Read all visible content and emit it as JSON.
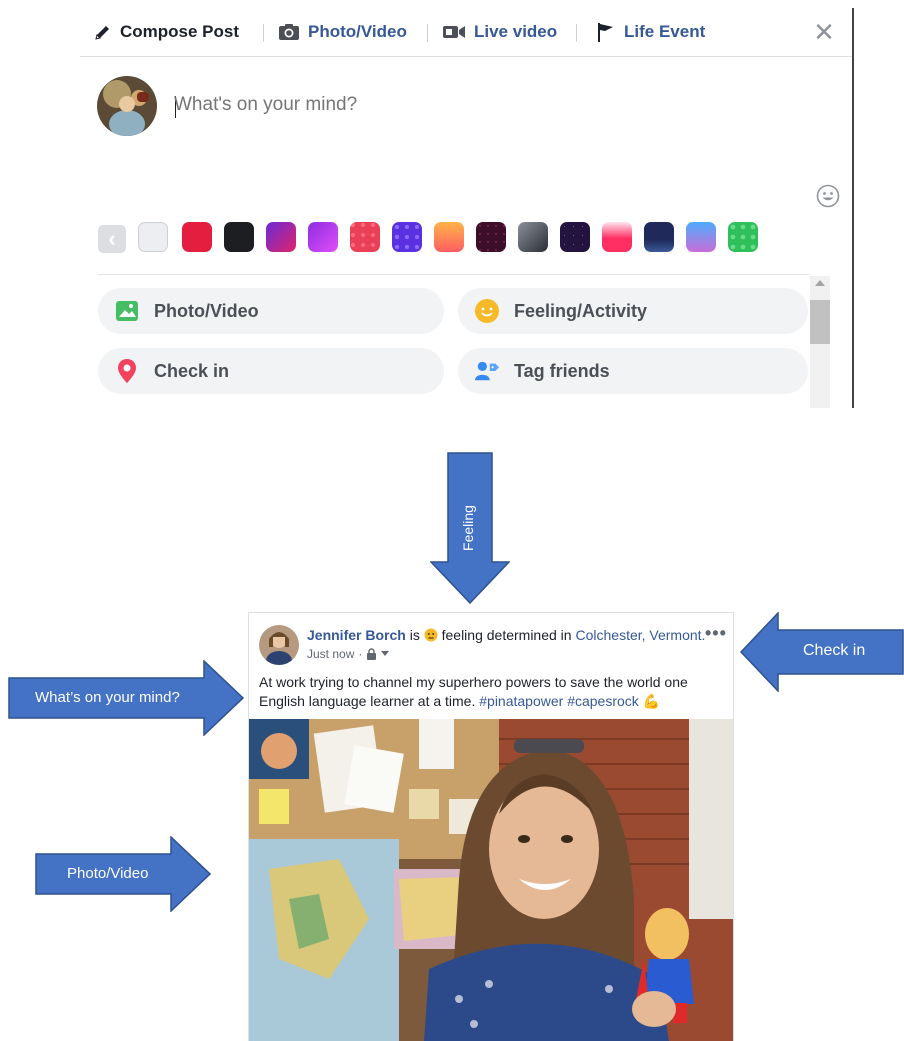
{
  "composer": {
    "tabs": {
      "compose": "Compose Post",
      "photo_video": "Photo/Video",
      "live_video": "Live video",
      "life_event": "Life Event"
    },
    "close_glyph": "✕",
    "placeholder": "What's on your mind?",
    "swatch_prev_glyph": "‹",
    "swatches": [
      "#e4e6eb",
      "#e41e3f",
      "#1c1e21",
      "#8e2de2",
      "#b83ef0",
      "#e94057",
      "#6a3df5",
      "#ff9a44",
      "#4a1230",
      "#3a3d46",
      "#2b1a52",
      "#ff2e63",
      "#1f2a5a",
      "#4facfe",
      "#2fbf5b"
    ],
    "options": {
      "photo_video": "Photo/Video",
      "feeling": "Feeling/Activity",
      "check_in": "Check in",
      "tag_friends": "Tag friends"
    },
    "icons": [
      "pencil-icon",
      "camera-icon",
      "video-camera-icon",
      "flag-icon",
      "close-icon",
      "emoji-icon",
      "image-icon",
      "smiley-icon",
      "location-pin-icon",
      "tag-person-icon"
    ]
  },
  "arrows": {
    "feeling": "Feeling",
    "check_in": "Check in",
    "whats_on_mind": "What’s on your mind?",
    "photo_video": "Photo/Video"
  },
  "post": {
    "author": "Jennifer Borch",
    "is": "is",
    "feeling_text": "feeling determined in",
    "location": "Colchester, Vermont.",
    "time": "Just now",
    "dot": "·",
    "menu_glyph": "•••",
    "text": "At work trying to channel my superhero powers to save the world one English language learner at a time.",
    "hashtags": "#pinatapower #capesrock",
    "emoji": "💪"
  },
  "colors": {
    "fb_link": "#365899",
    "arrow_blue": "#4472c4",
    "arrow_border": "#2f528f"
  }
}
